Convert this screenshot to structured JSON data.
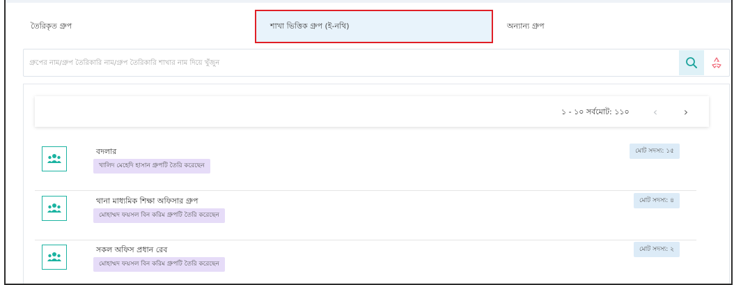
{
  "tabs": [
    {
      "label": "তৈরিকৃত গ্রুপ",
      "active": false
    },
    {
      "label": "শাখা ভিত্তিক গ্রুপ (ই-নথি)",
      "active": true
    },
    {
      "label": "অন্যান্য গ্রুপ",
      "active": false
    }
  ],
  "search": {
    "placeholder": "গ্রুপের নাম/গ্রুপ তৈরিকারি নাম/গ্রুপ তৈরিকারি শাখার নাম দিয়ে খুঁজুন",
    "search_icon": "search-icon",
    "reset_icon": "recycle-icon"
  },
  "pagination": {
    "text": "১ - ১০ সর্বমোট: ১১০",
    "prev_icon": "chevron-left-icon",
    "next_icon": "chevron-right-icon"
  },
  "groups": [
    {
      "name": "বদলার",
      "creator": "খালিদ মেহেদি হাসান গ্রুপটি তৈরি করেছেন",
      "member_count": "মোট সদস্য: ১৫",
      "icon": "users-icon"
    },
    {
      "name": "থানা মাধ্যমিক শিক্ষা অফিসার গ্রুপ",
      "creator": "মোহাম্মদ ফয়সল বিন করিম গ্রুপটি তৈরি করেছেন",
      "member_count": "মোট সদস্য: ৪",
      "icon": "users-icon"
    },
    {
      "name": "সকল অফিস প্রধান রেব",
      "creator": "মোহাম্মদ ফয়সল বিন করিম গ্রুপটি তৈরি করেছেন",
      "member_count": "মোট সদস্য: ২",
      "icon": "users-icon"
    }
  ],
  "colors": {
    "active_tab_border": "#e01f26",
    "active_tab_bg": "#e8f3fb",
    "avatar_border": "#1bb3a1",
    "creator_badge_bg": "#e6dcf8",
    "count_badge_bg": "#dcebf7"
  }
}
